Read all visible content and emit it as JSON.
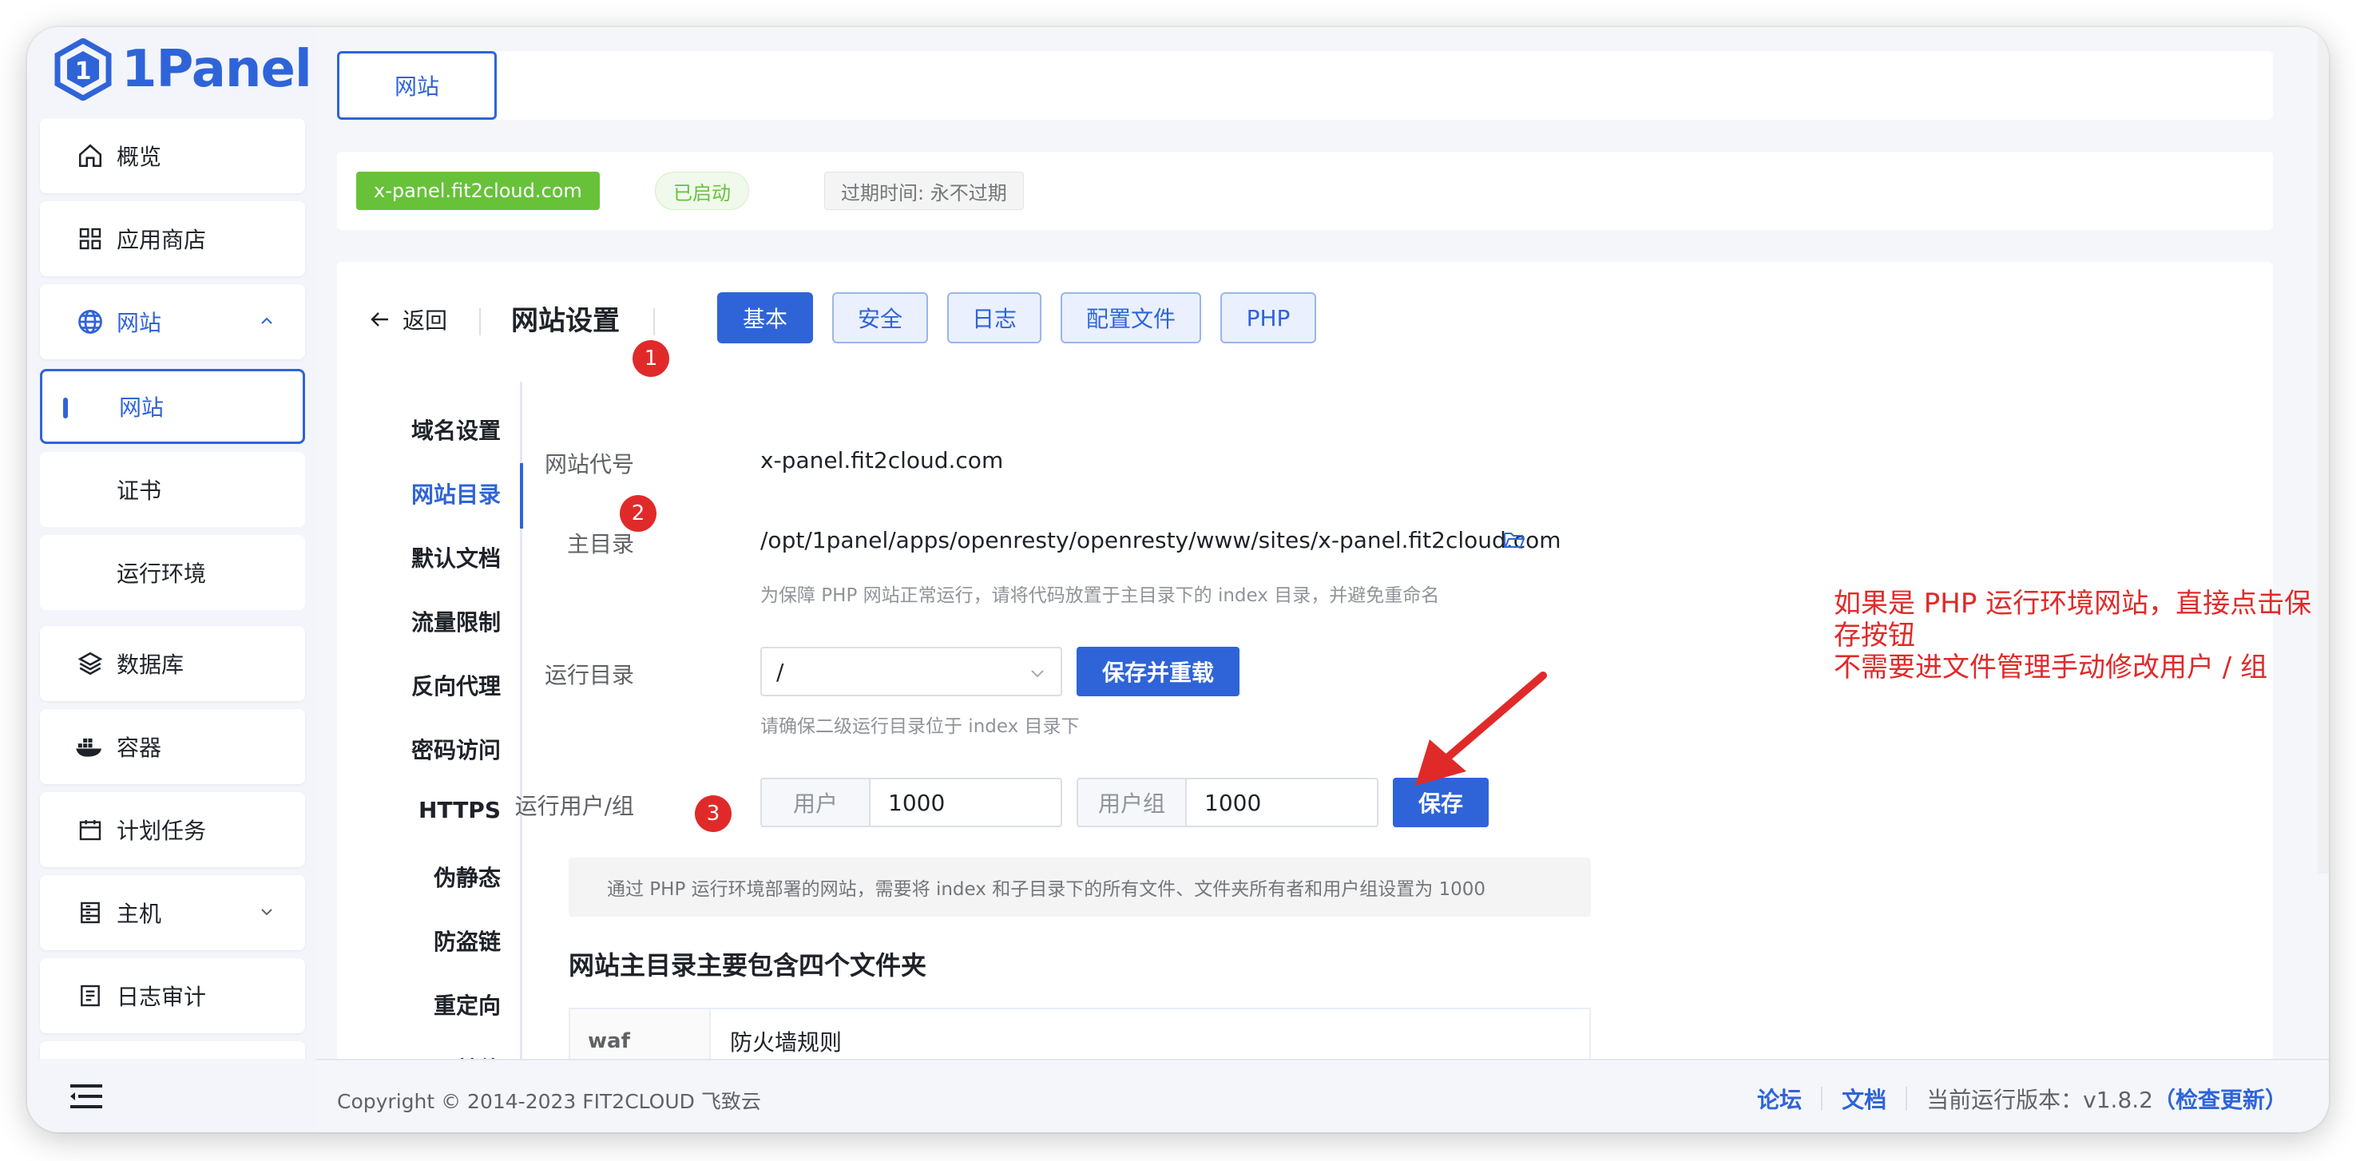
{
  "app": {
    "logo_text": "1Panel"
  },
  "sidebar": {
    "items": [
      {
        "label": "概览",
        "icon": "home-icon"
      },
      {
        "label": "应用商店",
        "icon": "grid-icon"
      },
      {
        "label": "网站",
        "icon": "globe-icon",
        "expanded": true
      },
      {
        "label": "数据库",
        "icon": "layers-icon"
      },
      {
        "label": "容器",
        "icon": "docker-icon"
      },
      {
        "label": "计划任务",
        "icon": "calendar-icon"
      },
      {
        "label": "主机",
        "icon": "server-icon"
      },
      {
        "label": "日志审计",
        "icon": "log-icon"
      }
    ],
    "sub_items": [
      {
        "label": "网站",
        "selected": true
      },
      {
        "label": "证书"
      },
      {
        "label": "运行环境"
      }
    ]
  },
  "topbar": {
    "tab_label": "网站"
  },
  "infobar": {
    "domain": "x-panel.fit2cloud.com",
    "status": "已启动",
    "expire": "过期时间: 永不过期"
  },
  "settings": {
    "back_label": "返回",
    "title": "网站设置",
    "tabs": [
      "基本",
      "安全",
      "日志",
      "配置文件",
      "PHP"
    ],
    "active_tab": "基本",
    "subnav": [
      "域名设置",
      "网站目录",
      "默认文档",
      "流量限制",
      "反向代理",
      "密码访问",
      "HTTPS",
      "伪静态",
      "防盗链",
      "重定向",
      "其他"
    ],
    "active_subnav": "网站目录"
  },
  "form": {
    "site_code_label": "网站代号",
    "site_code_value": "x-panel.fit2cloud.com",
    "root_dir_label": "主目录",
    "root_dir_value": "/opt/1panel/apps/openresty/openresty/www/sites/x-panel.fit2cloud.com",
    "root_dir_hint": "为保障 PHP 网站正常运行，请将代码放置于主目录下的 index 目录，并避免重命名",
    "run_dir_label": "运行目录",
    "run_dir_value": "/",
    "save_reload_label": "保存并重载",
    "run_dir_hint": "请确保二级运行目录位于 index 目录下",
    "run_user_label": "运行用户/组",
    "user_prefix": "用户",
    "user_value": "1000",
    "group_prefix": "用户组",
    "group_value": "1000",
    "save_label": "保存",
    "alert_text": "通过 PHP 运行环境部署的网站，需要将 index 和子目录下的所有文件、文件夹所有者和用户组设置为 1000",
    "section_title": "网站主目录主要包含四个文件夹",
    "table": [
      {
        "name": "waf",
        "desc": "防火墙规则"
      }
    ]
  },
  "annotations": {
    "badges": [
      "1",
      "2",
      "3"
    ],
    "line1": "如果是 PHP 运行环境网站，直接点击保存按钮",
    "line2": "不需要进文件管理手动修改用户 / 组",
    "color": "#e02a2a"
  },
  "footer": {
    "copyright": "Copyright © 2014-2023 FIT2CLOUD 飞致云",
    "forum": "论坛",
    "docs": "文档",
    "version_label": "当前运行版本：v1.8.2",
    "check_update": "（检查更新）"
  },
  "colors": {
    "primary": "#2f64d8",
    "success": "#67c23a",
    "annotation": "#e02a2a"
  }
}
